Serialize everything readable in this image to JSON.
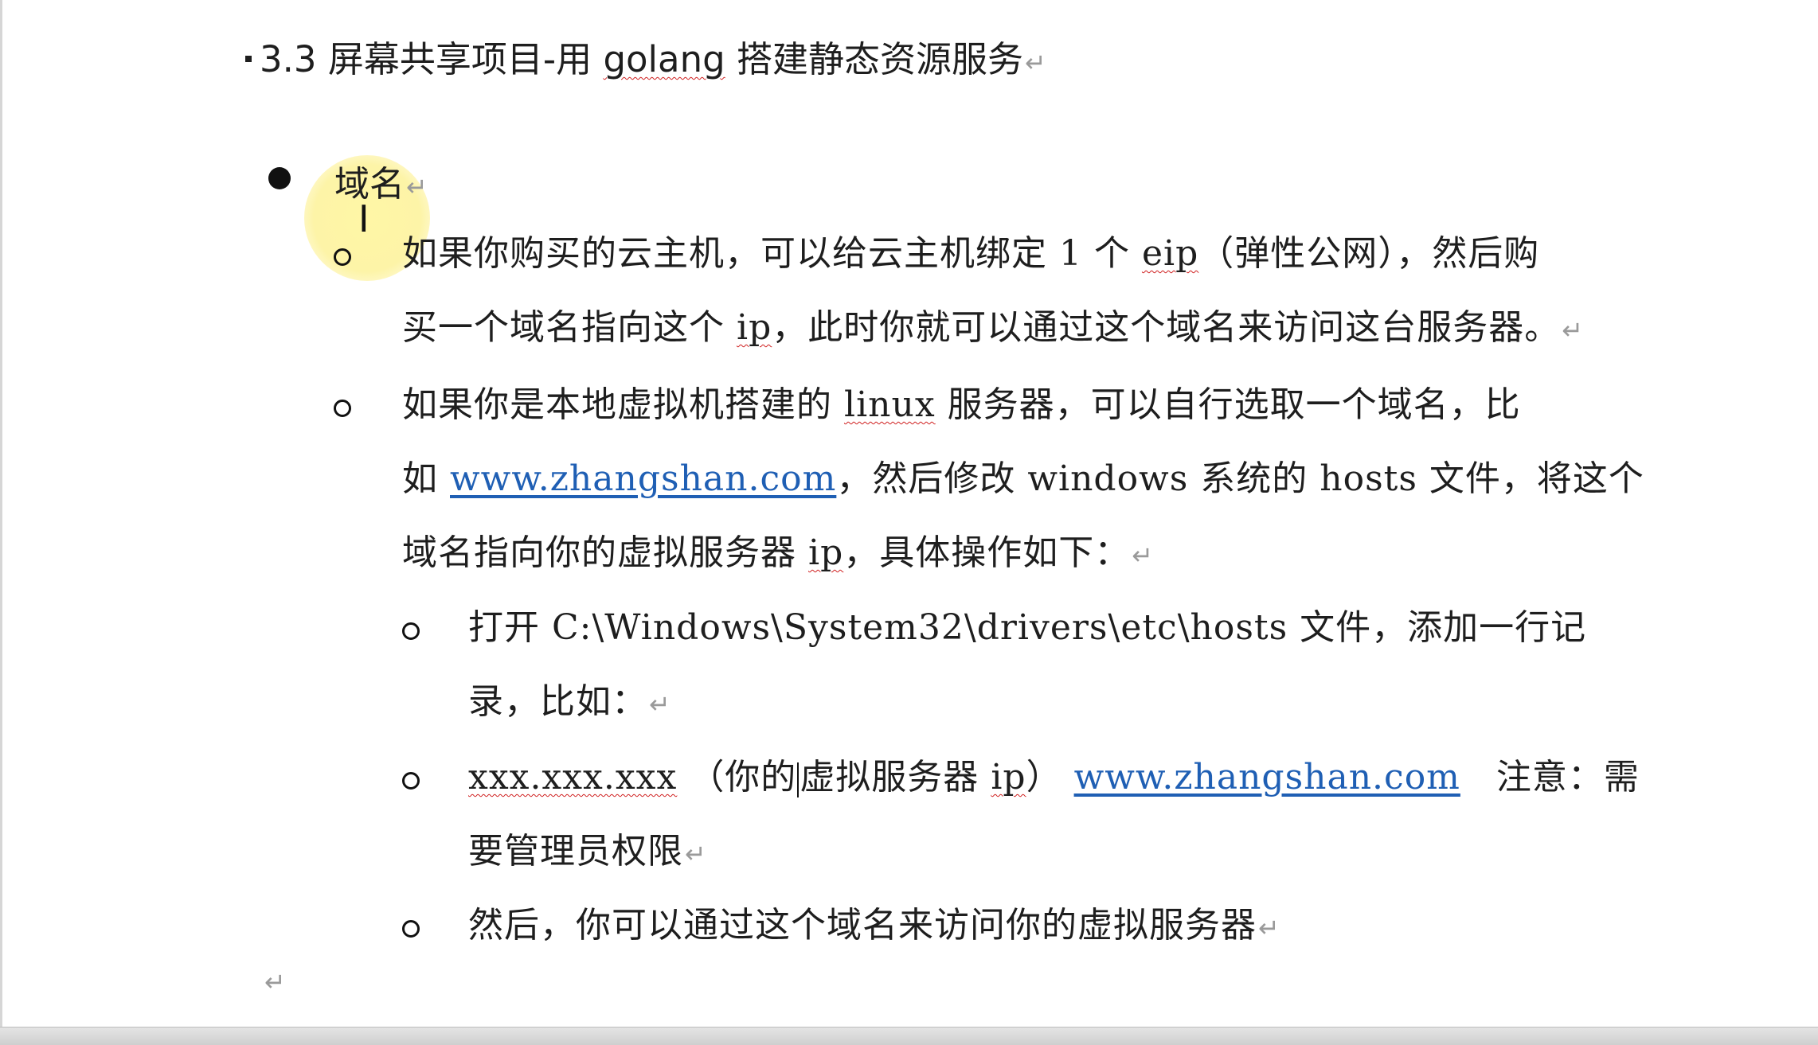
{
  "heading": {
    "number": "3.3",
    "title_prefix": "屏幕共享项目-用",
    "title_word": "golang",
    "title_suffix": "搭建静态资源服务"
  },
  "section": {
    "label": "域名"
  },
  "items": {
    "cloud": {
      "line1_a": "如果你购买的云主机，可以给云主机绑定 1 个",
      "line1_eip": "eip",
      "line1_b": "（弹性公网），然后购",
      "line2_a": "买一个域名指向这个",
      "line2_ip": "ip",
      "line2_b": "，此时你就可以通过这个域名来访问这台服务器。"
    },
    "local": {
      "line1_a": "如果你是本地虚拟机搭建的",
      "line1_linux": "linux",
      "line1_b": "服务器，可以自行选取一个域名，比",
      "line2_a": "如",
      "line2_link": "www.zhangshan.com",
      "line2_b": "，然后修改 windows 系统的 hosts 文件，将这个",
      "line3_a": "域名指向你的虚拟服务器",
      "line3_ip": "ip",
      "line3_b": "，具体操作如下："
    },
    "step1": {
      "line1": "打开 C:\\Windows\\System32\\drivers\\etc\\hosts 文件，添加一行记",
      "line2": "录，比如："
    },
    "step2": {
      "xxx": "xxx.xxx.xxx",
      "paren_a": "（你的",
      "paren_b": "虚拟服务器",
      "ip": "ip",
      "paren_c": "）",
      "link": "www.zhangshan.com",
      "note": "注意：需",
      "line2": "要管理员权限"
    },
    "step3": {
      "line1": "然后，你可以通过这个域名来访问你的虚拟服务器"
    }
  },
  "para_mark": "↵",
  "colors": {
    "link": "#1f5fb4",
    "spellcheck": "#d02020",
    "highlight": "#fbee7c"
  }
}
